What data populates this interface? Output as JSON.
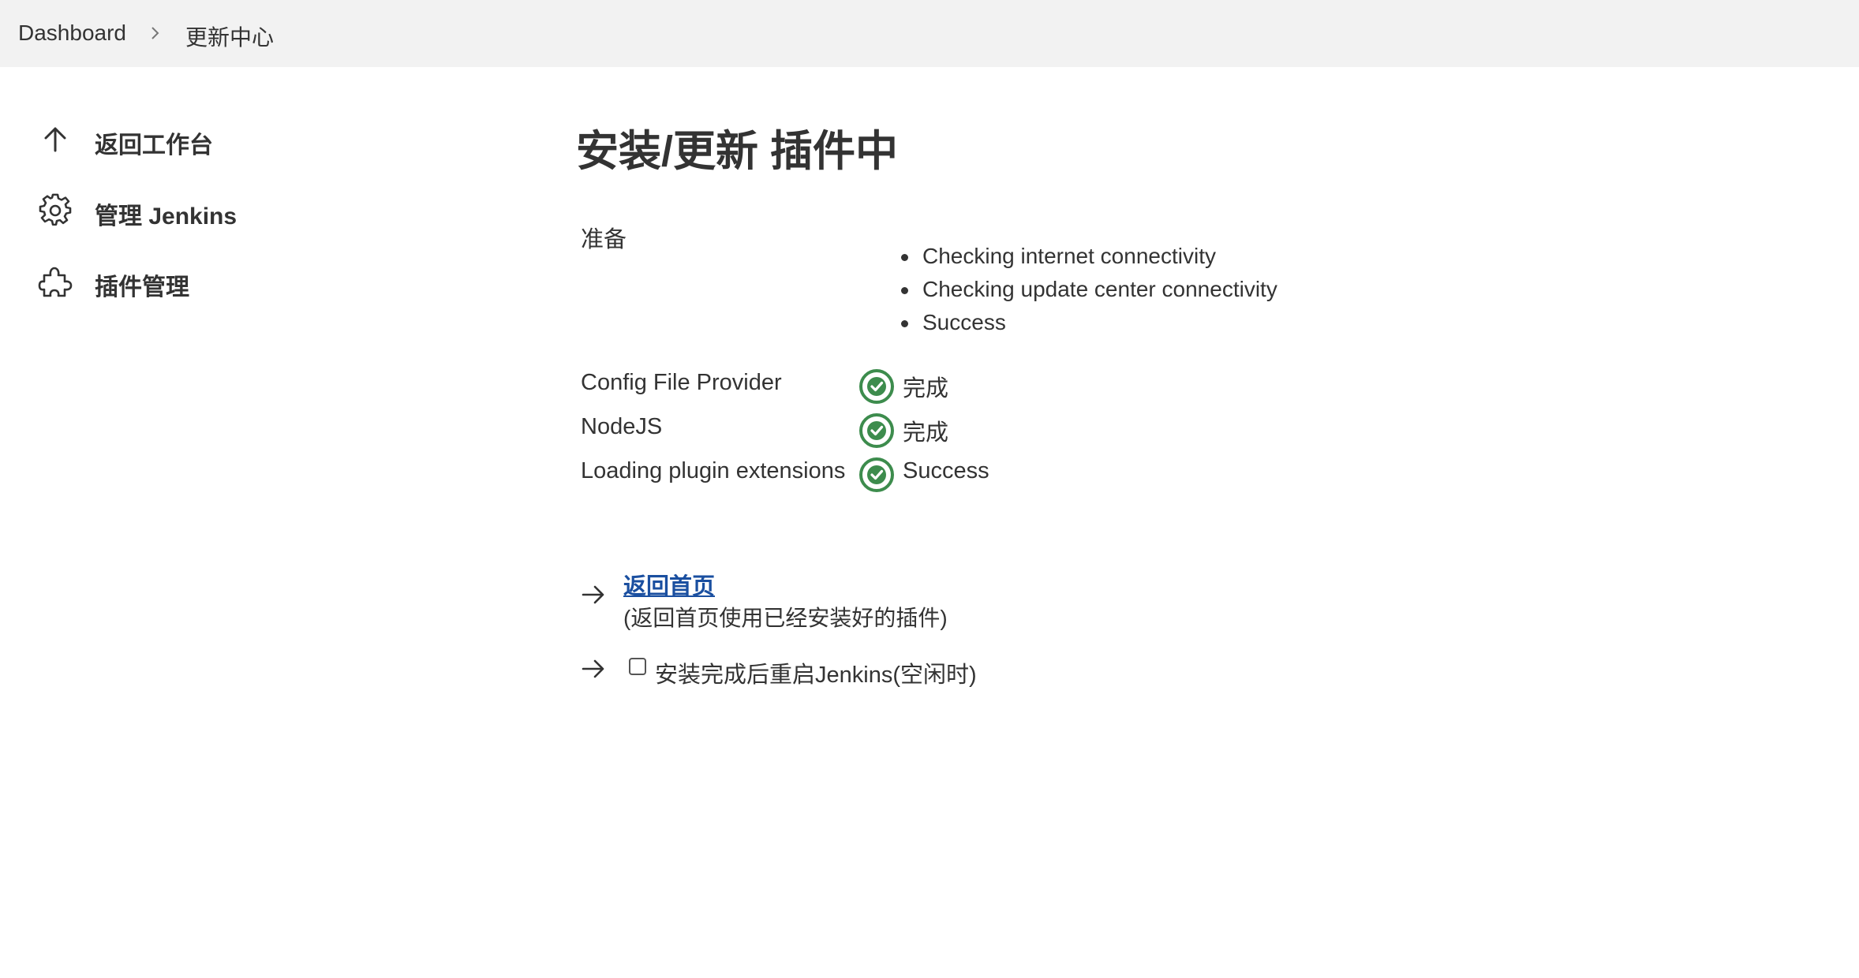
{
  "breadcrumb": {
    "items": [
      {
        "label": "Dashboard"
      },
      {
        "label": "更新中心"
      }
    ]
  },
  "sidebar": {
    "items": [
      {
        "label": "返回工作台",
        "icon": "arrow-up-icon"
      },
      {
        "label": "管理 Jenkins",
        "icon": "gear-icon"
      },
      {
        "label": "插件管理",
        "icon": "puzzle-icon"
      }
    ]
  },
  "main": {
    "title": "安装/更新 插件中",
    "preparation": {
      "label": "准备",
      "steps": [
        "Checking internet connectivity",
        "Checking update center connectivity",
        "Success"
      ]
    },
    "plugins": [
      {
        "name": "Config File Provider",
        "status": "完成"
      },
      {
        "name": "NodeJS",
        "status": "完成"
      },
      {
        "name": "Loading plugin extensions",
        "status": "Success"
      }
    ],
    "go_home": {
      "link": "返回首页",
      "description": "(返回首页使用已经安装好的插件)"
    },
    "restart": {
      "label": "安装完成后重启Jenkins(空闲时)",
      "checked": false
    }
  },
  "colors": {
    "success": "#3d8c4d",
    "link": "#1a4fa0",
    "topbar": "#f2f2f2"
  }
}
